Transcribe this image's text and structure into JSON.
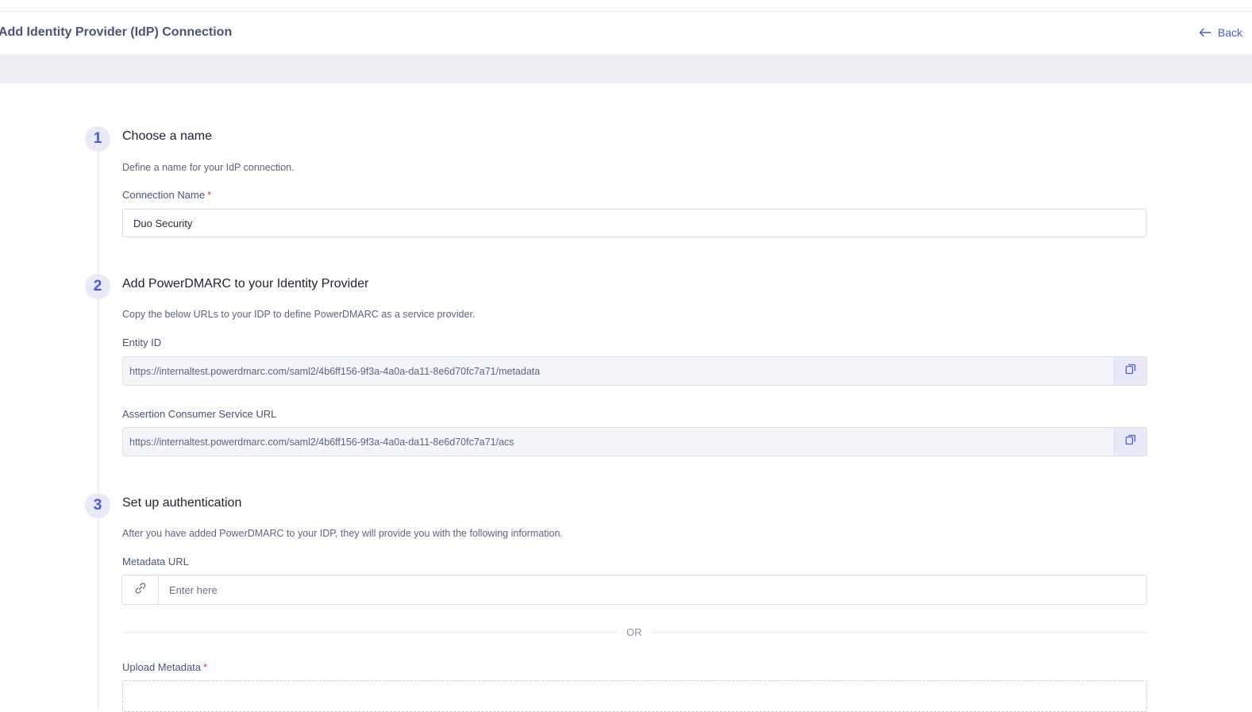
{
  "header": {
    "title": "Add Identity Provider (IdP) Connection",
    "back_label": "Back"
  },
  "steps": [
    {
      "number": "1",
      "title": "Choose a name",
      "description": "Define a name for your IdP connection.",
      "connection_name_label": "Connection Name",
      "required_marker": "*",
      "connection_name_value": "Duo Security"
    },
    {
      "number": "2",
      "title": "Add PowerDMARC to your Identity Provider",
      "description": "Copy the below URLs to your IDP to define PowerDMARC as a service provider.",
      "entity_id_label": "Entity ID",
      "entity_id_value": "https://internaltest.powerdmarc.com/saml2/4b6ff156-9f3a-4a0a-da11-8e6d70fc7a71/metadata",
      "acs_label": "Assertion Consumer Service URL",
      "acs_value": "https://internaltest.powerdmarc.com/saml2/4b6ff156-9f3a-4a0a-da11-8e6d70fc7a71/acs"
    },
    {
      "number": "3",
      "title": "Set up authentication",
      "description": "After you have added PowerDMARC to your IDP, they will provide you with the following information.",
      "metadata_url_label": "Metadata URL",
      "metadata_url_placeholder": "Enter here",
      "or_label": "OR",
      "upload_label": "Upload Metadata",
      "required_marker": "*"
    }
  ],
  "icons": {
    "back": "arrow-left-icon",
    "copy": "copy-icon",
    "link": "link-icon"
  },
  "colors": {
    "accent": "#4a5bd8",
    "step_bg": "#e8eaf8",
    "required": "#e03535"
  }
}
